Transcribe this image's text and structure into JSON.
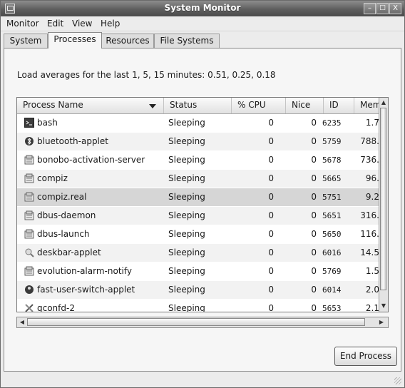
{
  "window": {
    "title": "System Monitor",
    "btn_minimize": "–",
    "btn_maximize": "□",
    "btn_close": "X"
  },
  "menubar": [
    "Monitor",
    "Edit",
    "View",
    "Help"
  ],
  "tabs": [
    "System",
    "Processes",
    "Resources",
    "File Systems"
  ],
  "active_tab": "Processes",
  "load_averages": "Load averages for the last 1, 5, 15 minutes: 0.51, 0.25, 0.18",
  "columns": [
    "Process Name",
    "Status",
    "% CPU",
    "Nice",
    "ID",
    "Memo"
  ],
  "processes": [
    {
      "name": "bash",
      "status": "Sleeping",
      "cpu": "0",
      "nice": "0",
      "id": "6235",
      "mem": "1.7",
      "icon": "terminal-icon"
    },
    {
      "name": "bluetooth-applet",
      "status": "Sleeping",
      "cpu": "0",
      "nice": "0",
      "id": "5759",
      "mem": "788.",
      "icon": "bluetooth-icon"
    },
    {
      "name": "bonobo-activation-server",
      "status": "Sleeping",
      "cpu": "0",
      "nice": "0",
      "id": "5678",
      "mem": "736.",
      "icon": "gear-icon"
    },
    {
      "name": "compiz",
      "status": "Sleeping",
      "cpu": "0",
      "nice": "0",
      "id": "5665",
      "mem": "96.",
      "icon": "gear-icon"
    },
    {
      "name": "compiz.real",
      "status": "Sleeping",
      "cpu": "0",
      "nice": "0",
      "id": "5751",
      "mem": "9.2",
      "icon": "gear-icon"
    },
    {
      "name": "dbus-daemon",
      "status": "Sleeping",
      "cpu": "0",
      "nice": "0",
      "id": "5651",
      "mem": "316.",
      "icon": "gear-icon"
    },
    {
      "name": "dbus-launch",
      "status": "Sleeping",
      "cpu": "0",
      "nice": "0",
      "id": "5650",
      "mem": "116.",
      "icon": "gear-icon"
    },
    {
      "name": "deskbar-applet",
      "status": "Sleeping",
      "cpu": "0",
      "nice": "0",
      "id": "6016",
      "mem": "14.5",
      "icon": "search-icon"
    },
    {
      "name": "evolution-alarm-notify",
      "status": "Sleeping",
      "cpu": "0",
      "nice": "0",
      "id": "5769",
      "mem": "1.5",
      "icon": "gear-icon"
    },
    {
      "name": "fast-user-switch-applet",
      "status": "Sleeping",
      "cpu": "0",
      "nice": "0",
      "id": "6014",
      "mem": "2.0",
      "icon": "user-icon"
    },
    {
      "name": "gconfd-2",
      "status": "Sleeping",
      "cpu": "0",
      "nice": "0",
      "id": "5653",
      "mem": "2.1",
      "icon": "tools-icon"
    }
  ],
  "selected_process": "compiz.real",
  "end_button": "End Process"
}
